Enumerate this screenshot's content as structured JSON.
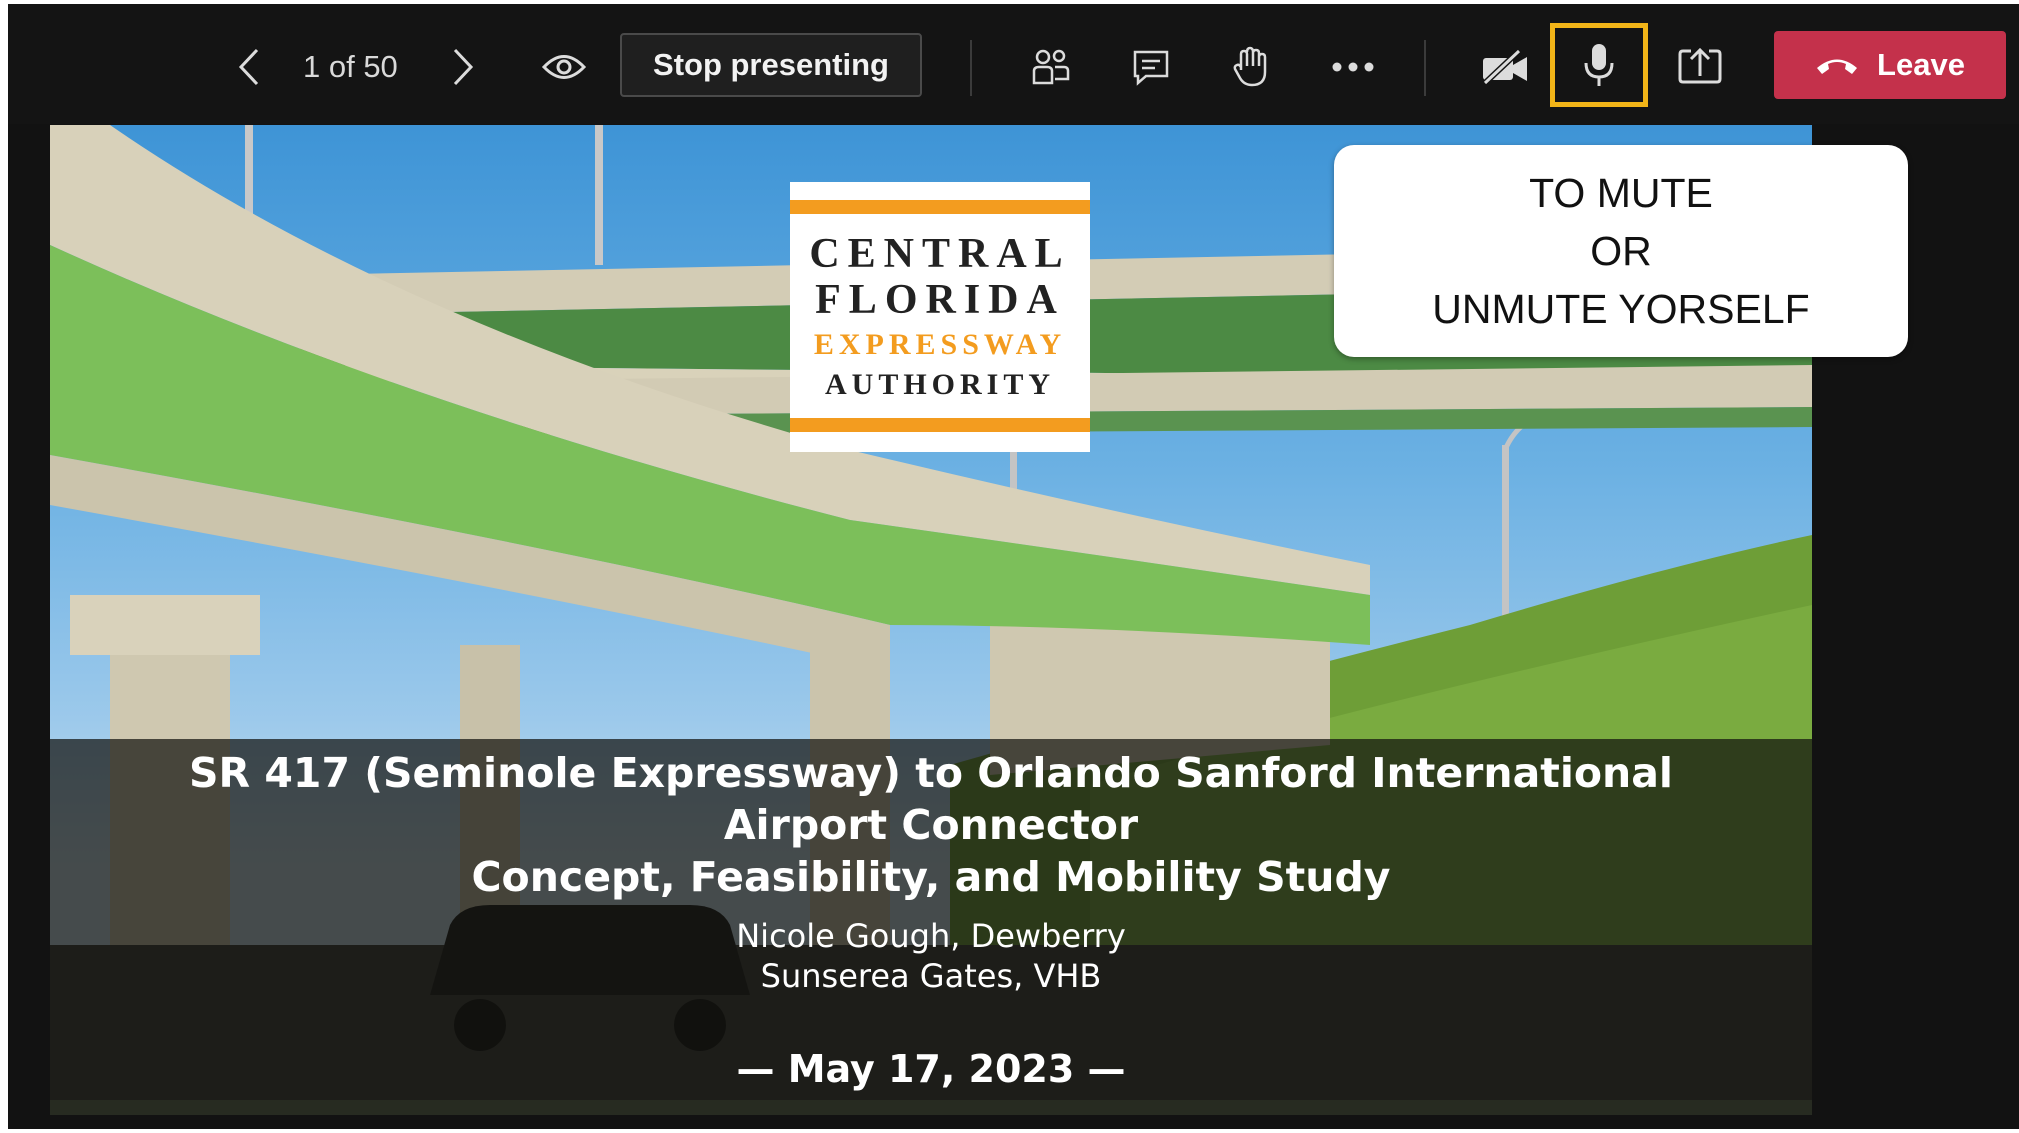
{
  "toolbar": {
    "counter": "1 of 50",
    "stop_label": "Stop presenting",
    "leave_label": "Leave",
    "highlight_color": "#f2b418",
    "leave_color": "#c4314b",
    "icons": [
      "chevron-left-icon",
      "chevron-right-icon",
      "eye-icon",
      "people-icon",
      "chat-icon",
      "raise-hand-icon",
      "more-icon",
      "camera-off-icon",
      "microphone-icon",
      "share-tray-icon",
      "phone-hangup-icon"
    ]
  },
  "slide": {
    "logo": {
      "line1": "CENTRAL",
      "line2": "FLORIDA",
      "line3": "EXPRESSWAY",
      "line4": "AUTHORITY",
      "accent": "#f39c1f"
    },
    "callout": {
      "line1": "TO MUTE",
      "line2": "OR",
      "line3": "UNMUTE YORSELF"
    },
    "title_line1": "SR 417 (Seminole Expressway) to Orlando Sanford International",
    "title_line2": "Airport Connector",
    "title_line3": "Concept, Feasibility, and Mobility Study",
    "presenter1": "Nicole Gough, Dewberry",
    "presenter2": "Sunserea Gates, VHB",
    "date": "— May 17, 2023 —"
  }
}
